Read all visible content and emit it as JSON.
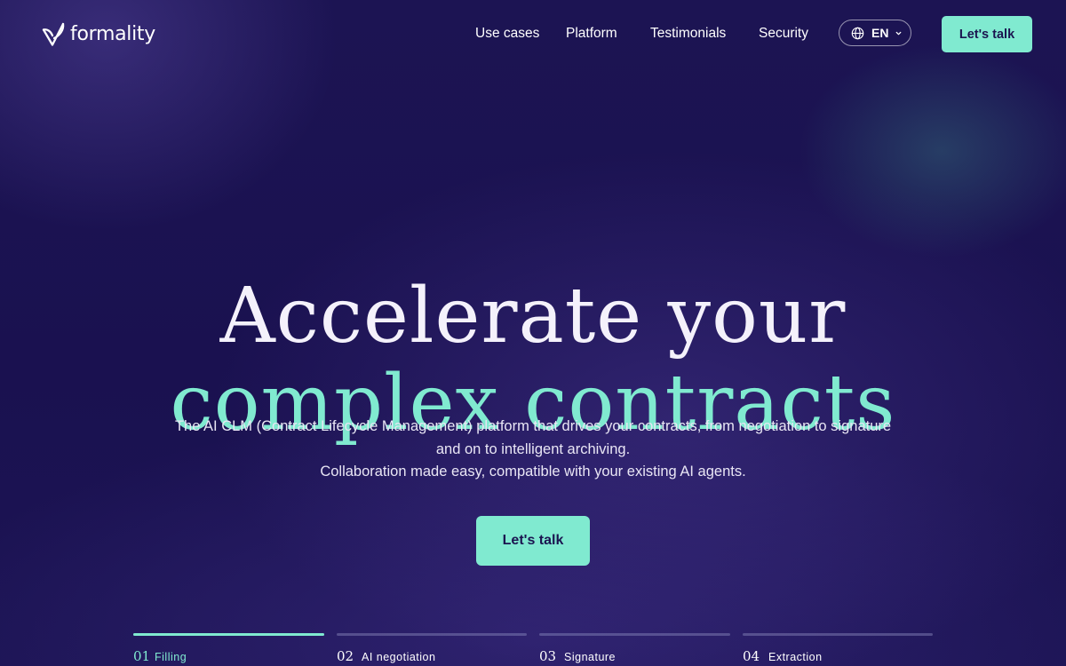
{
  "brand": {
    "name": "formality",
    "logo_icon": "check-leaf-icon"
  },
  "nav": {
    "links": [
      {
        "label": "Use cases"
      },
      {
        "label": "Platform"
      },
      {
        "label": "Testimonials"
      },
      {
        "label": "Security"
      }
    ],
    "language": {
      "code": "EN",
      "icon": "globe-icon",
      "dropdown_icon": "chevron-down-icon"
    },
    "cta_label": "Let's talk"
  },
  "hero": {
    "title_line_1": "Accelerate your",
    "title_line_2": "complex contracts",
    "subtitle_line_1": "The AI CLM (Contract Lifecycle Management) platform that drives your contracts, from negotiation to signature and on to intelligent archiving.",
    "subtitle_line_2": "Collaboration made easy, compatible with your existing AI agents.",
    "cta_label": "Let's talk"
  },
  "steps": [
    {
      "number": "01",
      "label": "Filling",
      "progress": 1.0,
      "active": true
    },
    {
      "number": "02",
      "label": "AI negotiation",
      "progress": 0,
      "active": false
    },
    {
      "number": "03",
      "label": "Signature",
      "progress": 0,
      "active": false
    },
    {
      "number": "04",
      "label": "Extraction",
      "progress": 0,
      "active": false
    }
  ],
  "colors": {
    "background": "#1a1250",
    "accent": "#80ead0",
    "text": "#ffffff",
    "button_text": "#1b1550"
  }
}
